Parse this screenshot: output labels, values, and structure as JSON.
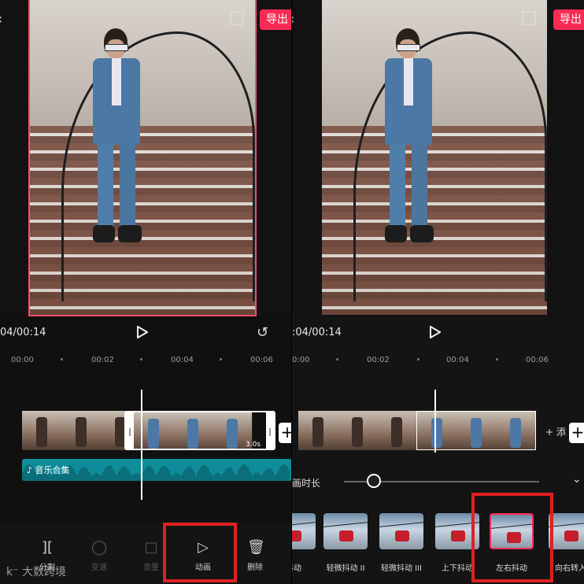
{
  "left": {
    "export_label": "导出",
    "time": "04/00:14",
    "ruler": [
      "00:00",
      "00:02",
      "00:04",
      "00:06"
    ],
    "clip_duration": "3.0s",
    "music_label": "音乐合集",
    "tools": [
      {
        "icon": "split-icon",
        "label": "分割"
      },
      {
        "icon": "speed-icon",
        "label": "变速"
      },
      {
        "icon": "volume-icon",
        "label": "音量"
      },
      {
        "icon": "animation-icon",
        "label": "动画"
      },
      {
        "icon": "delete-icon",
        "label": "删除"
      }
    ],
    "watermark": "大数跨境"
  },
  "right": {
    "export_label": "导出",
    "time": ":04/00:14",
    "ruler": [
      "0:00",
      "00:02",
      "00:04",
      "00:06"
    ],
    "add_label": "+ 添",
    "duration_label": "画时长",
    "animations": [
      {
        "label": "抖动"
      },
      {
        "label": "轻微抖动 II"
      },
      {
        "label": "轻微抖动 III"
      },
      {
        "label": "上下抖动"
      },
      {
        "label": "左右抖动"
      },
      {
        "label": "向右转入"
      }
    ],
    "selected_animation": "左右抖动",
    "duration_slider_fraction": 0.15
  },
  "colors": {
    "accent": "#fe2c55",
    "highlight": "#e02020",
    "music": "#0e8c9a"
  }
}
